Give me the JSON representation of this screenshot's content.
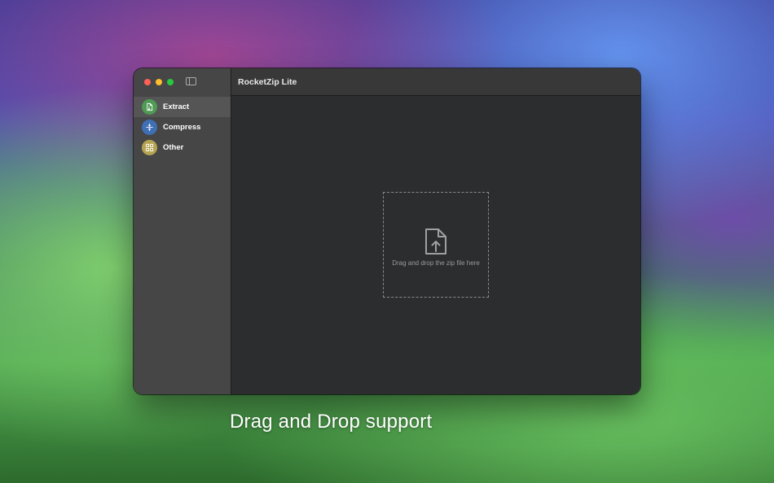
{
  "window": {
    "title": "RocketZip Lite"
  },
  "sidebar": {
    "items": [
      {
        "label": "Extract",
        "icon": "document-zip-icon",
        "icon_color": "#4f9a54",
        "selected": true
      },
      {
        "label": "Compress",
        "icon": "compress-arrows-icon",
        "icon_color": "#3f6fb5",
        "selected": false
      },
      {
        "label": "Other",
        "icon": "grid-icon",
        "icon_color": "#b5a553",
        "selected": false
      }
    ]
  },
  "dropzone": {
    "icon": "file-upload-icon",
    "text": "Drag and drop the zip file here"
  },
  "caption": "Drag and Drop support"
}
